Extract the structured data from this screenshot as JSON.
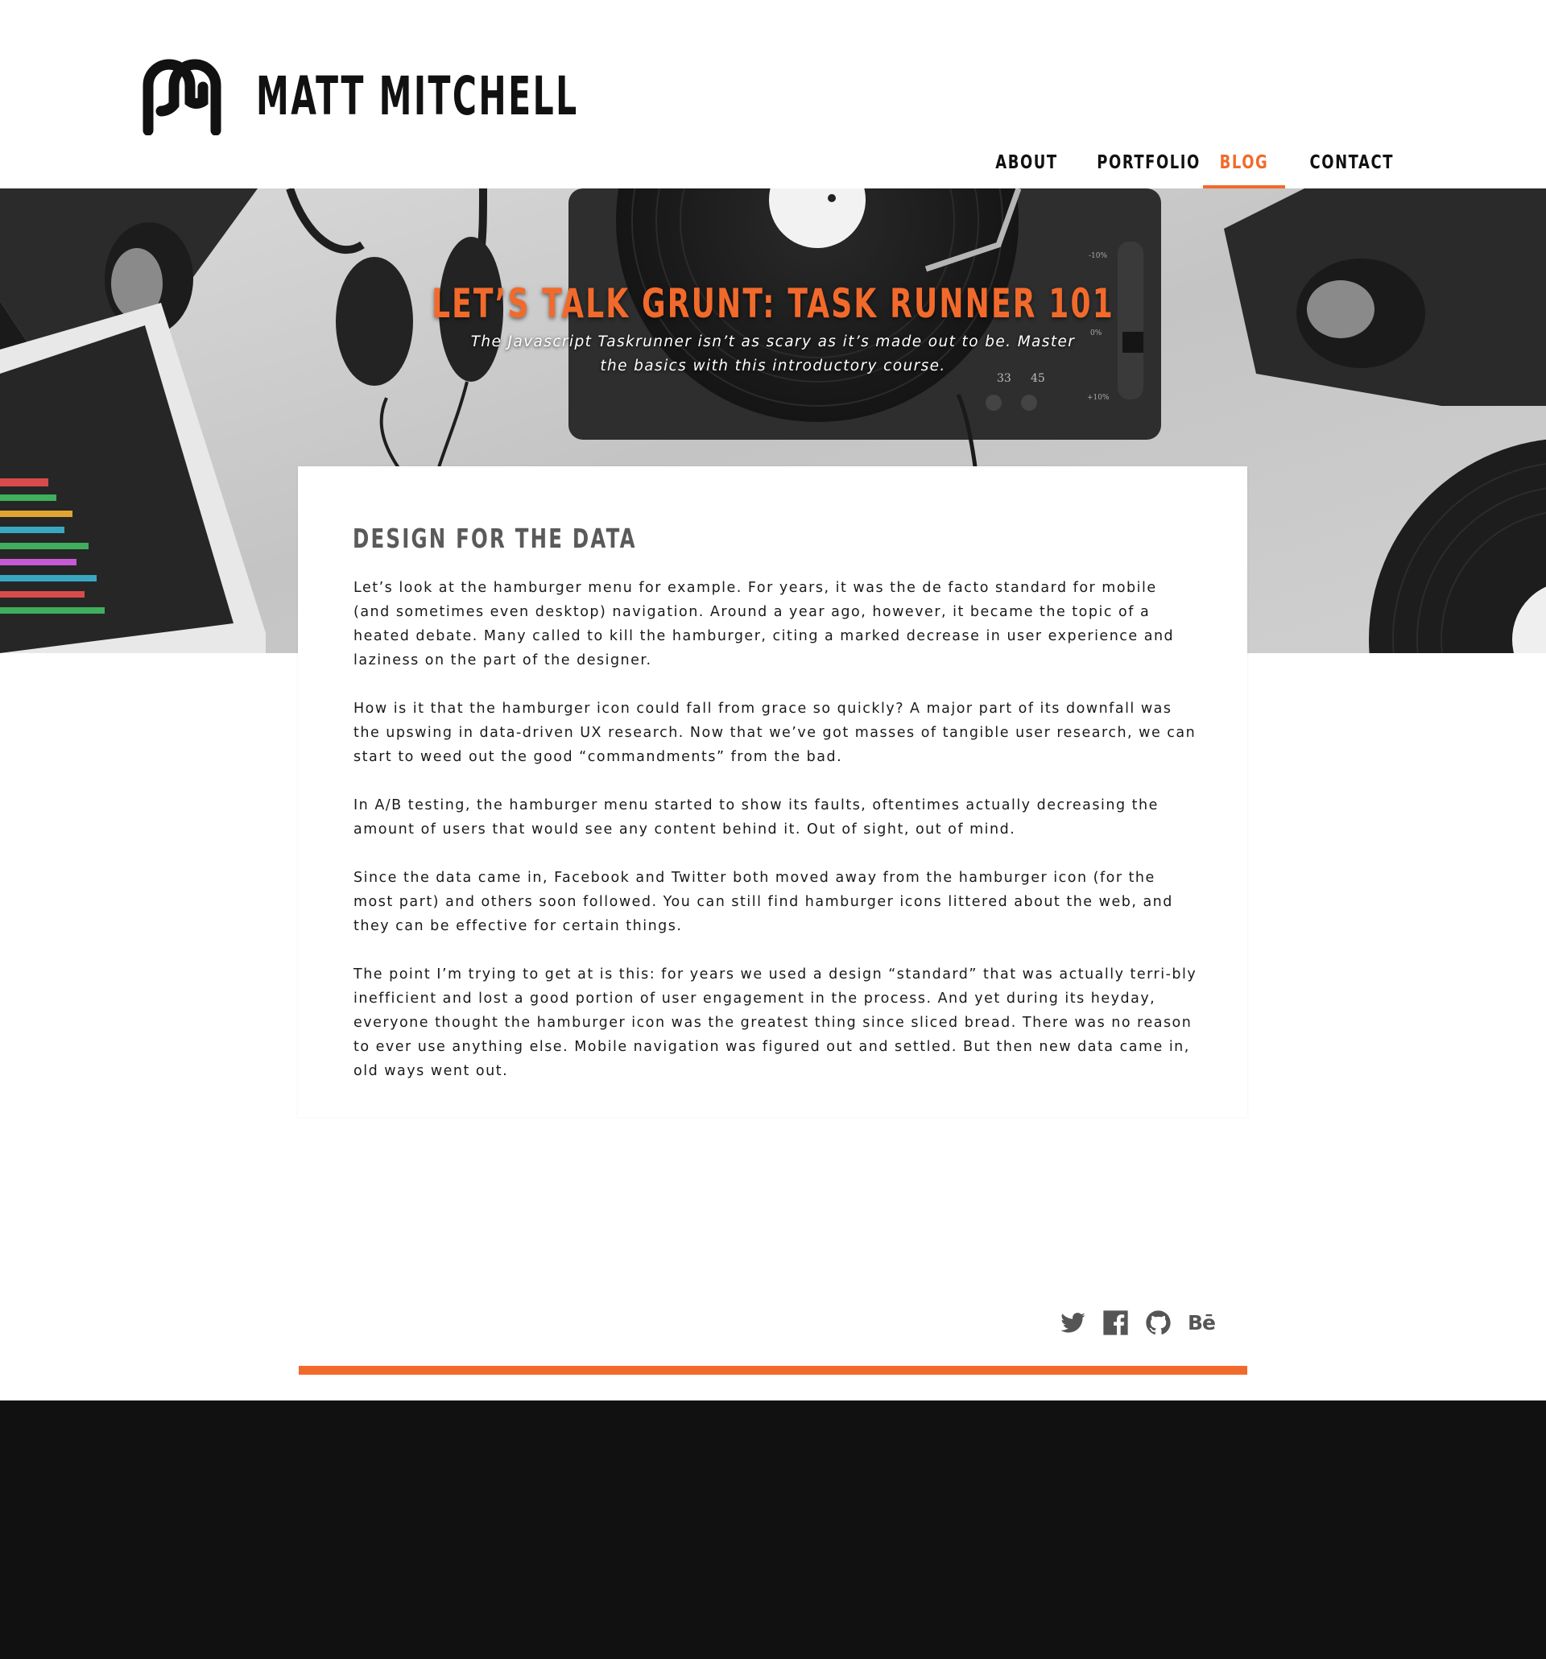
{
  "brand": {
    "name": "MATT MITCHELL"
  },
  "nav": {
    "items": [
      {
        "label": "ABOUT",
        "active": false
      },
      {
        "label": "PORTFOLIO",
        "active": false
      },
      {
        "label": "BLOG",
        "active": true
      },
      {
        "label": "CONTACT",
        "active": false
      }
    ]
  },
  "hero": {
    "title": "LET’S TALK GRUNT: TASK RUNNER 101",
    "subtitle": "The Javascript Taskrunner isn’t as scary as it’s made out to be. Master the basics with this introductory course.",
    "turntable_labels": [
      "33",
      "45",
      "-10%",
      "0%",
      "+10%"
    ]
  },
  "article": {
    "heading": "DESIGN FOR THE DATA",
    "paragraphs": [
      "Let’s look at the hamburger menu for example. For years, it was the de facto standard for mobile (and sometimes even desktop) navigation. Around a year ago, however, it became the topic of a heated debate. Many called to kill the hamburger, citing a marked decrease in user experience and laziness on the part of the designer.",
      "How is it that the hamburger icon could fall from grace so quickly? A major part of its downfall was the upswing in data-driven UX research. Now that we’ve got masses of tangible user research, we can start to weed out the good “commandments” from the bad.",
      "In A/B testing, the hamburger menu started to show its faults, oftentimes actually decreasing the amount of users that would see any content behind it. Out of sight, out of mind.",
      "Since the data came in, Facebook and Twitter both moved away from the hamburger icon (for the most part) and others soon followed. You can still find hamburger icons littered about the web, and they can be effective for certain things.",
      "The point I’m trying to get at is this: for years we used a design “standard” that was actually terri-bly inefficient and lost a good portion of user engagement in the process. And yet during its heyday, everyone thought the hamburger icon was the greatest thing since sliced bread. There was no reason to ever use anything else. Mobile navigation was figured out and settled. But then new data came in, old ways went out."
    ]
  },
  "social": {
    "icons": [
      "twitter-icon",
      "facebook-icon",
      "github-icon",
      "behance-icon"
    ],
    "behance_label": "Bē"
  },
  "colors": {
    "accent": "#f26a2b",
    "text": "#1a1a1a",
    "heading_gray": "#5a5a5a",
    "footer_bg": "#111111",
    "icon_gray": "#555555"
  }
}
